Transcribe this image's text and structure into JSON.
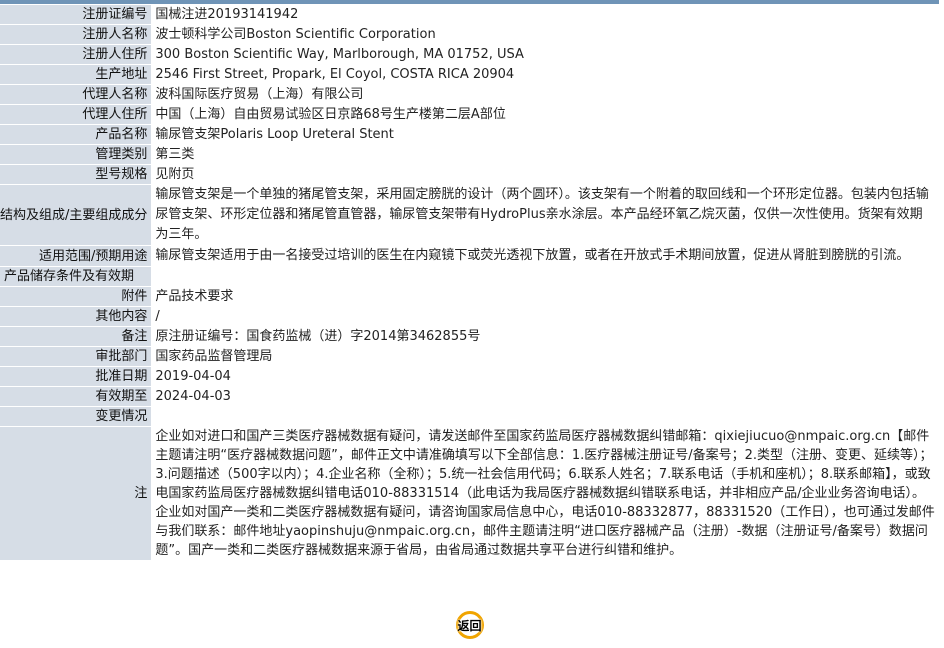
{
  "rows": [
    {
      "label": "注册证编号",
      "value": "国械注进20193141942"
    },
    {
      "label": "注册人名称",
      "value": "波士顿科学公司Boston Scientific Corporation"
    },
    {
      "label": "注册人住所",
      "value": "300 Boston Scientific Way, Marlborough, MA 01752, USA"
    },
    {
      "label": "生产地址",
      "value": "2546 First Street, Propark, El Coyol, COSTA RICA 20904"
    },
    {
      "label": "代理人名称",
      "value": "波科国际医疗贸易（上海）有限公司"
    },
    {
      "label": "代理人住所",
      "value": "中国（上海）自由贸易试验区日京路68号生产楼第二层A部位"
    },
    {
      "label": "产品名称",
      "value": "输尿管支架Polaris Loop Ureteral Stent"
    },
    {
      "label": "管理类别",
      "value": "第三类"
    },
    {
      "label": "型号规格",
      "value": "见附页"
    },
    {
      "label": "结构及组成/主要组成成分",
      "value": "输尿管支架是一个单独的猪尾管支架，采用固定膀胱的设计（两个圆环）。该支架有一个附着的取回线和一个环形定位器。包装内包括输尿管支架、环形定位器和猪尾管直管器，输尿管支架带有HydroPlus亲水涂层。本产品经环氧乙烷灭菌，仅供一次性使用。货架有效期为三年。"
    },
    {
      "label": "适用范围/预期用途",
      "value": "输尿管支架适用于由一名接受过培训的医生在内窥镜下或荧光透视下放置，或者在开放式手术期间放置，促进从肾脏到膀胱的引流。"
    },
    {
      "label": "产品储存条件及有效期",
      "value": ""
    },
    {
      "label": "附件",
      "value": "产品技术要求"
    },
    {
      "label": "其他内容",
      "value": "/"
    },
    {
      "label": "备注",
      "value": "原注册证编号：国食药监械（进）字2014第3462855号"
    },
    {
      "label": "审批部门",
      "value": "国家药品监督管理局"
    },
    {
      "label": "批准日期",
      "value": "2019-04-04"
    },
    {
      "label": "有效期至",
      "value": "2024-04-03"
    },
    {
      "label": "变更情况",
      "value": ""
    }
  ],
  "note": {
    "label": "注",
    "text": "企业如对进口和国产三类医疗器械数据有疑问，请发送邮件至国家药监局医疗器械数据纠错邮箱：qixiejiucuo@nmpaic.org.cn【邮件主题请注明“医疗器械数据问题”，邮件正文中请准确填写以下全部信息：1.医疗器械注册证号/备案号；2.类型（注册、变更、延续等）；3.问题描述（500字以内）；4.企业名称（全称）；5.统一社会信用代码；6.联系人姓名；7.联系电话（手机和座机）；8.联系邮箱】，或致电国家药监局医疗器械数据纠错电话010-88331514（此电话为我局医疗器械数据纠错联系电话，并非相应产品/企业业务咨询电话）。企业如对国产一类和二类医疗器械数据有疑问，请咨询国家局信息中心，电话010-88332877，88331520（工作日），也可通过发邮件与我们联系：邮件地址yaopinshuju@nmpaic.org.cn，邮件主题请注明“进口医疗器械产品（注册）-数据（注册证号/备案号）数据问题”。国产一类和二类医疗器械数据来源于省局，由省局通过数据共享平台进行纠错和维护。"
  },
  "back_button": {
    "label": "返回",
    "icon": "ring-icon",
    "accent": "#f0a400"
  },
  "colors": {
    "label_bg": "#d6dde6",
    "top_bar": "#6f94b7"
  }
}
